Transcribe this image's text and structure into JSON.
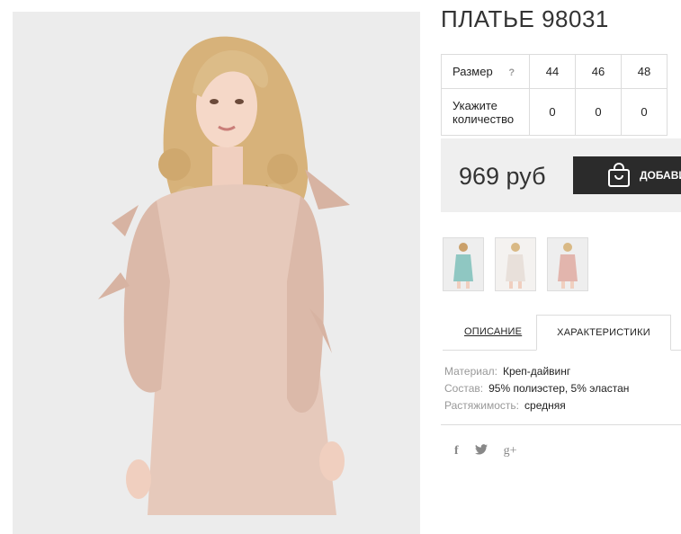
{
  "product": {
    "title": "ПЛАТЬЕ 98031",
    "image_alt": "woman in beige dress with bow sleeves"
  },
  "size_table": {
    "size_label": "Размер",
    "help_label": "?",
    "sizes": [
      "44",
      "46",
      "48"
    ],
    "quantity_label": "Укажите количество",
    "quantities": [
      "0",
      "0",
      "0"
    ]
  },
  "purchase": {
    "price": "969 руб",
    "add_button_label": "ДОБАВИТЬ"
  },
  "thumbnails": [
    {
      "name": "thumbnail-mint",
      "color": "#8fc7c2"
    },
    {
      "name": "thumbnail-white",
      "color": "#e8e0da"
    },
    {
      "name": "thumbnail-pink",
      "color": "#e2b5ad"
    }
  ],
  "tabs": {
    "description": "ОПИСАНИЕ",
    "characteristics": "ХАРАКТЕРИСТИКИ"
  },
  "specs": [
    {
      "key": "Материал:",
      "value": "Креп-дайвинг"
    },
    {
      "key": "Состав:",
      "value": "95% полиэстер, 5% эластан"
    },
    {
      "key": "Растяжимость:",
      "value": "средняя"
    }
  ],
  "social": {
    "facebook": "f",
    "twitter": "twitter-icon",
    "googleplus": "g+"
  },
  "colors": {
    "dress": "#e6c9bb",
    "hair": "#d9b985",
    "button_bg": "#2b2b2b",
    "buybox_bg": "#efefef"
  }
}
